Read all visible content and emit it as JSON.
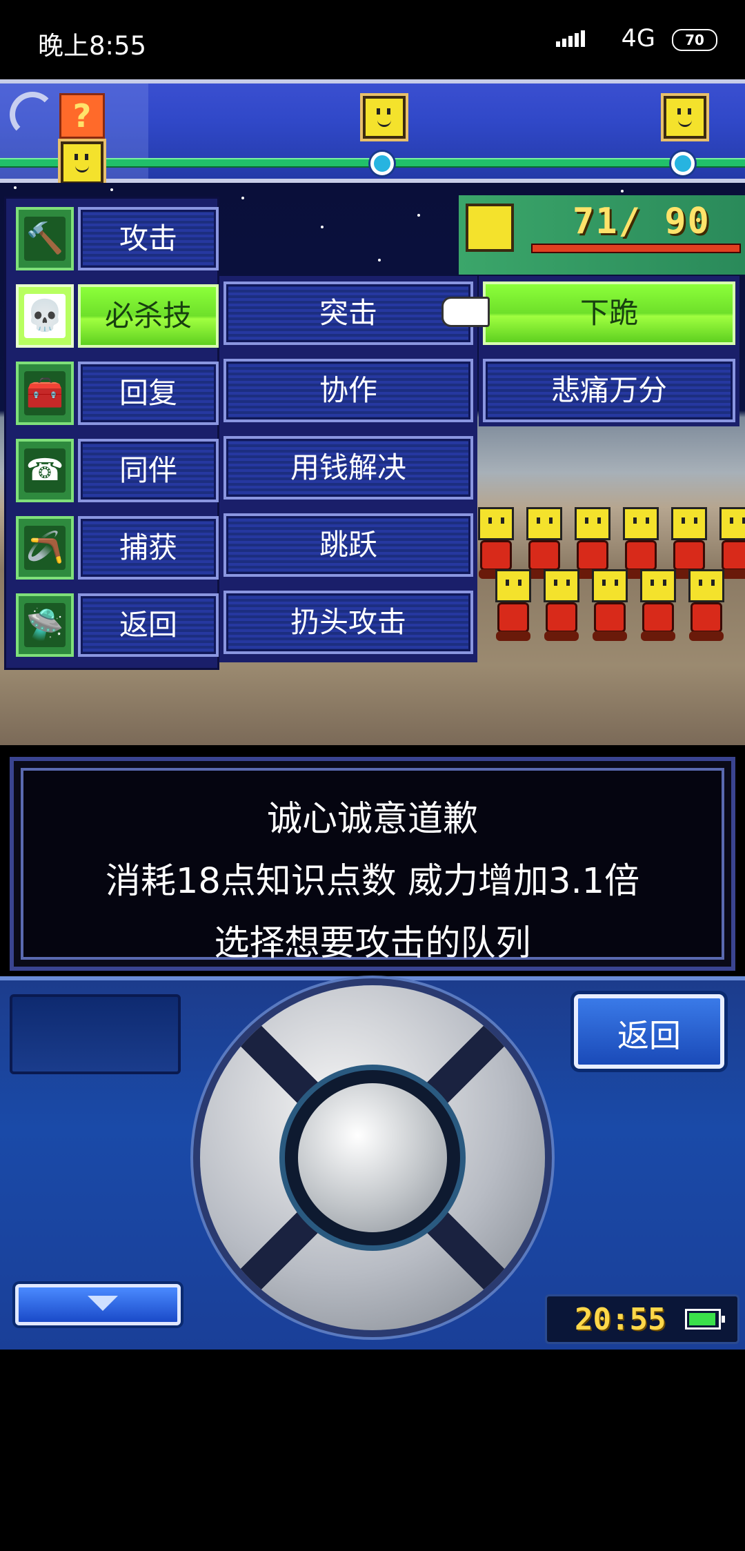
{
  "status_bar": {
    "time": "晚上8:55",
    "network": "4G",
    "battery": "70"
  },
  "menu": {
    "main": [
      {
        "label": "攻击",
        "icon": "hammer-icon",
        "glyph": "🔨",
        "selected": false
      },
      {
        "label": "必杀技",
        "icon": "skull-icon",
        "glyph": "💀",
        "selected": true
      },
      {
        "label": "回复",
        "icon": "medkit-icon",
        "glyph": "🧰",
        "selected": false
      },
      {
        "label": "同伴",
        "icon": "telephone-icon",
        "glyph": "☎",
        "selected": false
      },
      {
        "label": "捕获",
        "icon": "net-icon",
        "glyph": "🪃",
        "selected": false
      },
      {
        "label": "返回",
        "icon": "ufo-icon",
        "glyph": "🛸",
        "selected": false
      }
    ],
    "skills_col2": [
      "突击",
      "协作",
      "用钱解决",
      "跳跃",
      "扔头攻击"
    ],
    "skills_col3": [
      "下跪",
      "悲痛万分"
    ],
    "selected_skill": "下跪"
  },
  "party_hp": {
    "value": "71/ 90"
  },
  "message": {
    "line1": "诚心诚意道歉",
    "line2": "消耗18点知识点数 威力增加3.1倍",
    "line3": "选择想要攻击的队列"
  },
  "controller": {
    "back_label": "返回",
    "clock": "20:55"
  },
  "colors": {
    "menu_blue": "#2638a0",
    "selected_green": "#8cff3a",
    "hp_text": "#ffe36a"
  }
}
